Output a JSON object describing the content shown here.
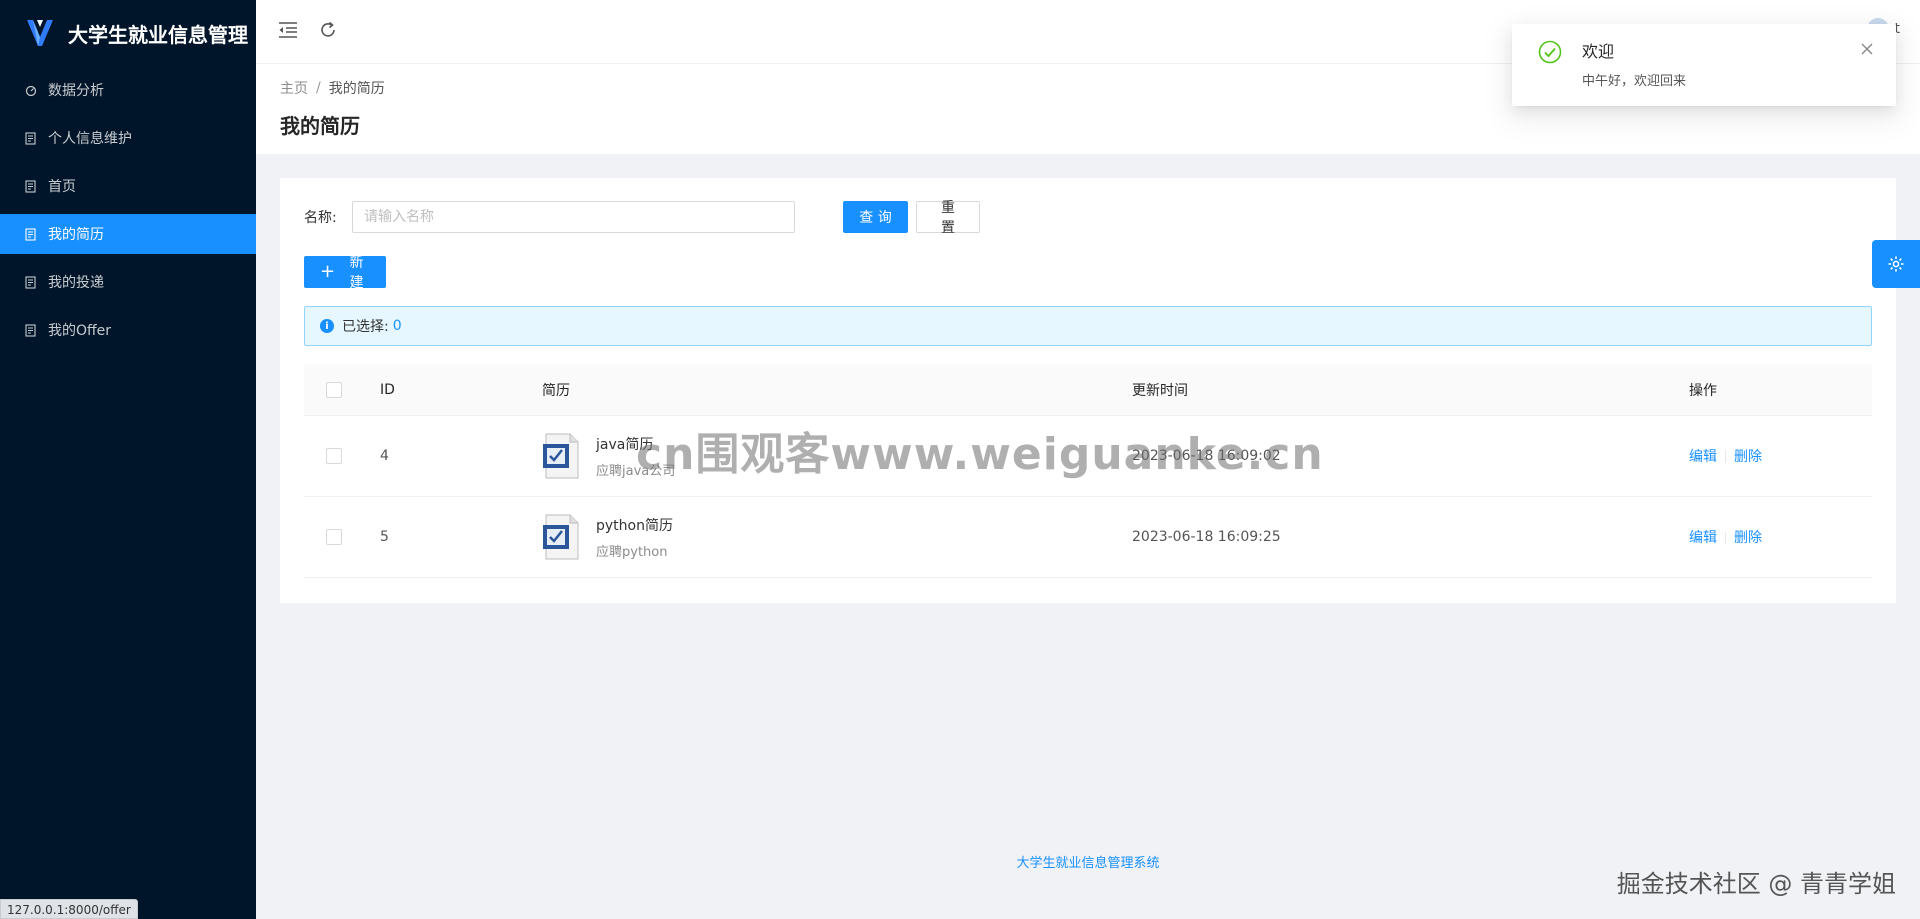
{
  "app": {
    "title": "大学生就业信息管理"
  },
  "sidebar": {
    "items": [
      {
        "label": "数据分析",
        "icon": "dashboard-icon"
      },
      {
        "label": "个人信息维护",
        "icon": "profile-icon"
      },
      {
        "label": "首页",
        "icon": "home-icon"
      },
      {
        "label": "我的简历",
        "icon": "resume-icon",
        "active": true
      },
      {
        "label": "我的投递",
        "icon": "delivery-icon"
      },
      {
        "label": "我的Offer",
        "icon": "offer-icon"
      }
    ]
  },
  "header": {
    "user_name": "t"
  },
  "breadcrumb": {
    "home": "主页",
    "separator": "/",
    "current": "我的简历"
  },
  "page": {
    "title": "我的简历"
  },
  "search": {
    "label": "名称:",
    "placeholder": "请输入名称",
    "value": "",
    "query_label": "查 询",
    "reset_label": "重 置"
  },
  "toolbar": {
    "new_label": "新建"
  },
  "alert": {
    "text": "已选择:",
    "count": "0"
  },
  "table": {
    "headers": {
      "id": "ID",
      "resume": "简历",
      "updated": "更新时间",
      "ops": "操作"
    },
    "rows": [
      {
        "id": "4",
        "name": "java简历",
        "desc": "应聘java公司",
        "updated": "2023-06-18 16:09:02",
        "edit": "编辑",
        "delete": "删除"
      },
      {
        "id": "5",
        "name": "python简历",
        "desc": "应聘python",
        "updated": "2023-06-18 16:09:25",
        "edit": "编辑",
        "delete": "删除"
      }
    ]
  },
  "footer": {
    "text": "大学生就业信息管理系统"
  },
  "notification": {
    "title": "欢迎",
    "message": "中午好，欢迎回来"
  },
  "status_bar": {
    "url": "127.0.0.1:8000/offer"
  },
  "watermarks": {
    "center": "cn围观客www.weiguanke.cn",
    "corner": "掘金技术社区 @ 青青学姐"
  },
  "colors": {
    "sidebar_bg": "#001529",
    "primary": "#1890ff",
    "success": "#52c41a"
  }
}
